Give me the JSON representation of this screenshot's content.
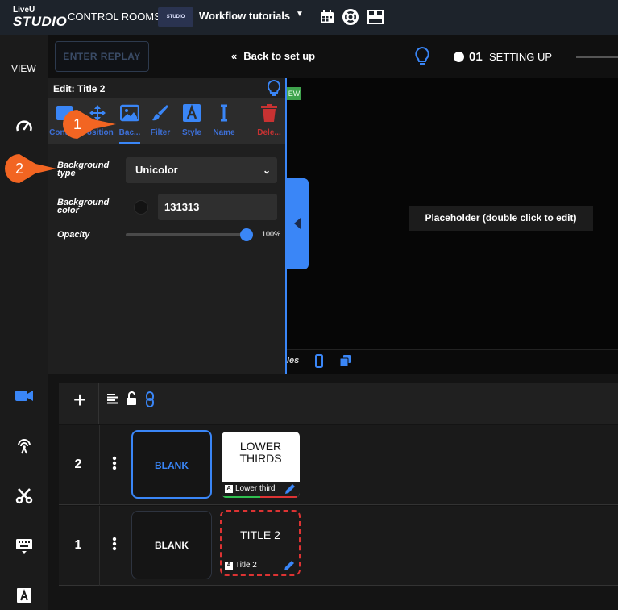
{
  "app": {
    "logo_top": "LiveU",
    "logo_main": "STUDIO",
    "control_rooms": "CONTROL ROOMS",
    "room_thumb_text": "STUDIO",
    "room_name": "Workflow tutorials",
    "accent_color": "#3a86f7"
  },
  "nav": {
    "view_label": "VIEW",
    "icons": [
      "gauge-icon",
      "camera-icon",
      "broadcast-icon",
      "scissors-icon",
      "keyboard-icon",
      "text-icon"
    ]
  },
  "subbar": {
    "enter_replay": "ENTER REPLAY",
    "back_arrow": "«",
    "back_label": "Back to set up",
    "status_number": "01",
    "status_label": "SETTING UP"
  },
  "preview": {
    "tag": "EW",
    "placeholder": "Placeholder (double click to edit)",
    "bottom_text": "les"
  },
  "edit_panel": {
    "title": "Edit: Title 2",
    "tabs": [
      {
        "label": "Content",
        "icon": "content-icon"
      },
      {
        "label": "Position",
        "icon": "move-icon"
      },
      {
        "label": "Bac...",
        "icon": "image-icon"
      },
      {
        "label": "Filter",
        "icon": "brush-icon"
      },
      {
        "label": "Style",
        "icon": "style-icon"
      },
      {
        "label": "Name",
        "icon": "text-cursor-icon"
      },
      {
        "label": "Dele...",
        "icon": "trash-icon"
      }
    ],
    "bg_type_label_1": "Background",
    "bg_type_label_2": "type",
    "bg_type_value": "Unicolor",
    "bg_color_label_1": "Background",
    "bg_color_label_2": "color",
    "bg_color_value": "131313",
    "opacity_label": "Opacity",
    "opacity_value": "100%",
    "opacity_fraction": 1.0
  },
  "callouts": {
    "one": "1",
    "two": "2",
    "color": "#f26522"
  },
  "layers": {
    "rows": [
      {
        "number": "2",
        "blank_label": "BLANK",
        "graphic_title_1": "LOWER",
        "graphic_title_2": "THIRDS",
        "graphic_name": "Lower third"
      },
      {
        "number": "1",
        "blank_label": "BLANK",
        "graphic_title_1": "TITLE 2",
        "graphic_name": "Title 2"
      }
    ]
  }
}
